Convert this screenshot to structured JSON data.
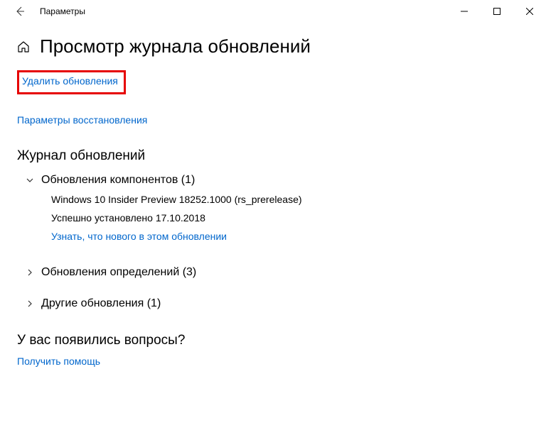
{
  "window": {
    "title": "Параметры"
  },
  "page": {
    "title": "Просмотр журнала обновлений"
  },
  "links": {
    "uninstall": "Удалить обновления",
    "recovery": "Параметры восстановления"
  },
  "history": {
    "heading": "Журнал обновлений",
    "sections": [
      {
        "label": "Обновления компонентов (1)",
        "expanded": true,
        "items": [
          {
            "title": "Windows 10 Insider Preview 18252.1000 (rs_prerelease)",
            "status": "Успешно установлено 17.10.2018",
            "link": "Узнать, что нового в этом обновлении"
          }
        ]
      },
      {
        "label": "Обновления определений (3)",
        "expanded": false
      },
      {
        "label": "Другие обновления (1)",
        "expanded": false
      }
    ]
  },
  "help": {
    "heading": "У вас появились вопросы?",
    "link": "Получить помощь"
  }
}
